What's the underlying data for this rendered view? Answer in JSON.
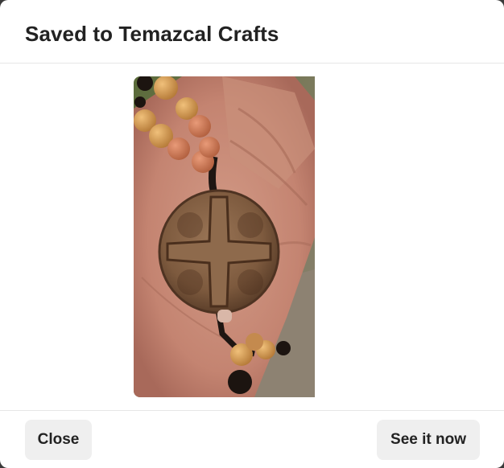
{
  "modal": {
    "title": "Saved to Temazcal Crafts"
  },
  "image": {
    "description_icon": "pin-image"
  },
  "footer": {
    "close_label": "Close",
    "see_label": "See it now"
  }
}
